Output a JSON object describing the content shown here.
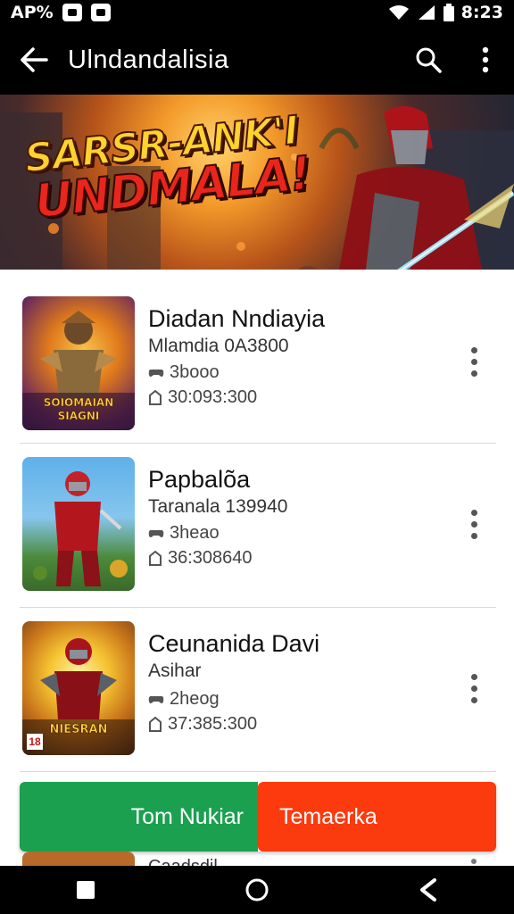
{
  "status_bar": {
    "left_text": "AP%",
    "time": "8:23"
  },
  "app_bar": {
    "title": "Ulndandalisia"
  },
  "banner": {
    "title_line1": "SARSR-ANK'I",
    "title_line2": "UNDMALA!"
  },
  "items": [
    {
      "title": "Diadan Nndiayia",
      "subtitle": "Mlamdia 0A3800",
      "meta1": "3booo",
      "meta2": "30:093:300",
      "thumb_caption": "SOIOMAIAN SIAGNI"
    },
    {
      "title": "Papbalõa",
      "subtitle": "Taranala 139940",
      "meta1": "3heao",
      "meta2": "36:308640",
      "thumb_caption": ""
    },
    {
      "title": "Ceunanida Davi",
      "subtitle": "Asihar",
      "meta1": "2heog",
      "meta2": "37:385:300",
      "thumb_caption": "NIESRAN",
      "thumb_badge": "18"
    }
  ],
  "actions": {
    "primary_label": "Tom Nukiar",
    "secondary_label": "Temaerka"
  },
  "peek": {
    "text": "Caadsdil..."
  },
  "colors": {
    "accent_green": "#1aa04f",
    "accent_red": "#fb3a0e",
    "bar_bg": "#000000"
  }
}
